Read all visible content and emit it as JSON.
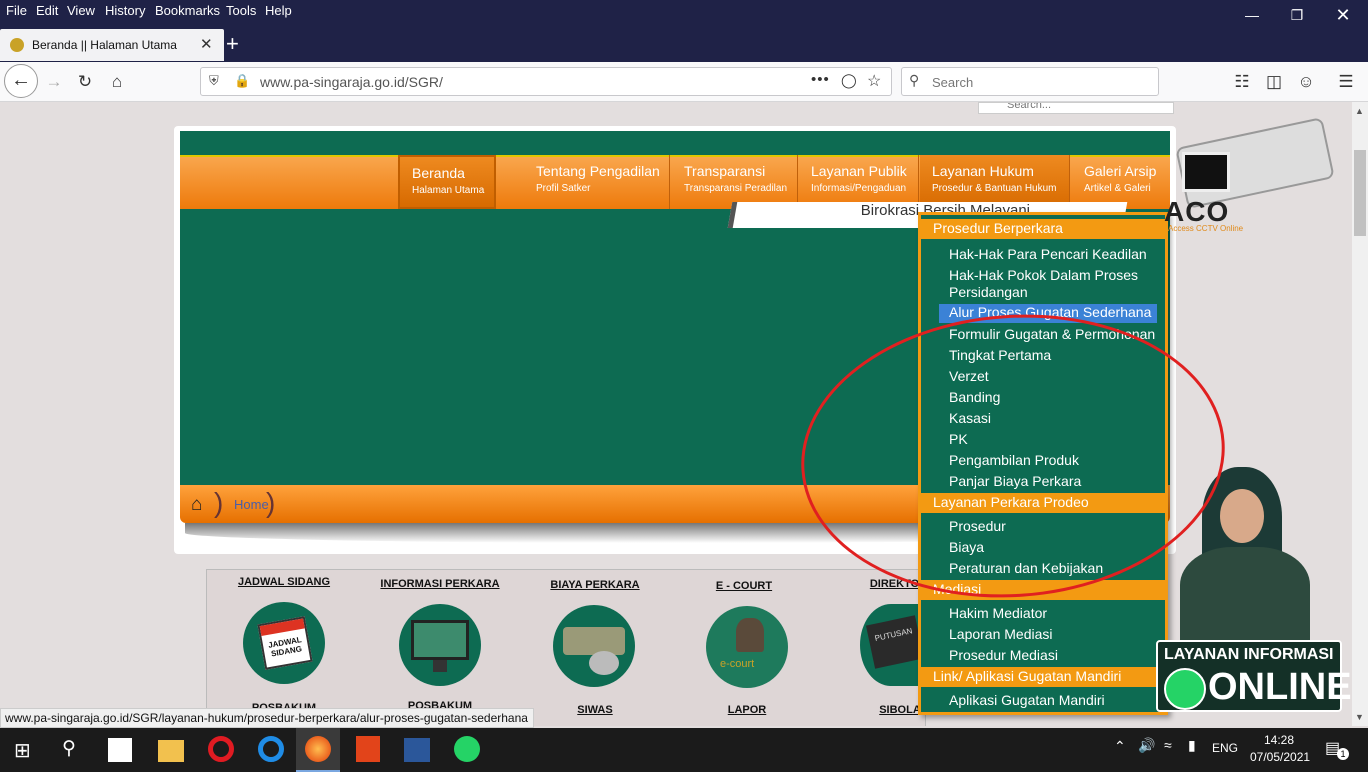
{
  "browser": {
    "menu": [
      "File",
      "Edit",
      "View",
      "History",
      "Bookmarks",
      "Tools",
      "Help"
    ],
    "tab_title": "Beranda || Halaman Utama",
    "url": "www.pa-singaraja.go.id/SGR/",
    "search_placeholder": "Search",
    "status_url": "www.pa-singaraja.go.id/SGR/layanan-hukum/prosedur-berperkara/alur-proses-gugatan-sederhana"
  },
  "site": {
    "page_search_placeholder": "Search...",
    "nav": [
      {
        "title": "Beranda",
        "sub": "Halaman Utama"
      },
      {
        "title": "Tentang Pengadilan",
        "sub": "Profil Satker"
      },
      {
        "title": "Transparansi",
        "sub": "Transparansi Peradilan"
      },
      {
        "title": "Layanan Publik",
        "sub": "Informasi/Pengaduan"
      },
      {
        "title": "Layanan Hukum",
        "sub": "Prosedur & Bantuan Hukum"
      },
      {
        "title": "Galeri Arsip",
        "sub": "Artikel & Galeri"
      }
    ],
    "slide_text": "Birokrasi Bersih Melayani",
    "breadcrumb": "Home",
    "quick_links": [
      "JADWAL SIDANG",
      "INFORMASI PERKARA",
      "BIAYA PERKARA",
      "E - COURT",
      "DIREKTORI"
    ],
    "quick_links_bottom": [
      "POSBAKUM",
      "POSBAKUM",
      "SIWAS",
      "LAPOR",
      "SIBOLA"
    ],
    "icon_captions": {
      "jadwal": "JADWAL SIDANG",
      "putusan": "PUTUSAN",
      "ecourt": "e-court"
    },
    "dropdown": {
      "sections": [
        {
          "title": "Prosedur Berperkara",
          "items": [
            "Hak-Hak Para Pencari Keadilan",
            "Hak-Hak Pokok Dalam Proses Persidangan",
            "Alur Proses Gugatan Sederhana",
            "Formulir Gugatan & Permohonan",
            "Tingkat Pertama",
            "Verzet",
            "Banding",
            "Kasasi",
            "PK",
            "Pengambilan Produk",
            "Panjar Biaya Perkara"
          ]
        },
        {
          "title": "Layanan Perkara Prodeo",
          "items": [
            "Prosedur",
            "Biaya",
            "Peraturan dan Kebijakan"
          ]
        },
        {
          "title": "Mediasi",
          "items": [
            "Hakim Mediator",
            "Laporan Mediasi",
            "Prosedur Mediasi"
          ]
        },
        {
          "title": "Link/ Aplikasi Gugatan Mandiri",
          "items": [
            "Aplikasi Gugatan Mandiri"
          ]
        }
      ],
      "selected": "Alur Proses Gugatan Sederhana"
    },
    "aco": {
      "logo": "ACO",
      "tagline": "Access CCTV Online"
    },
    "banner": {
      "line1": "LAYANAN INFORMASI",
      "line2": "ONLINE"
    }
  },
  "taskbar": {
    "lang": "ENG",
    "time": "14:28",
    "date": "07/05/2021",
    "notif": "1"
  },
  "colors": {
    "green": "#0d6b52",
    "orange": "#f39a12",
    "selected": "#3b82d6",
    "titlebar": "#1f2247"
  }
}
